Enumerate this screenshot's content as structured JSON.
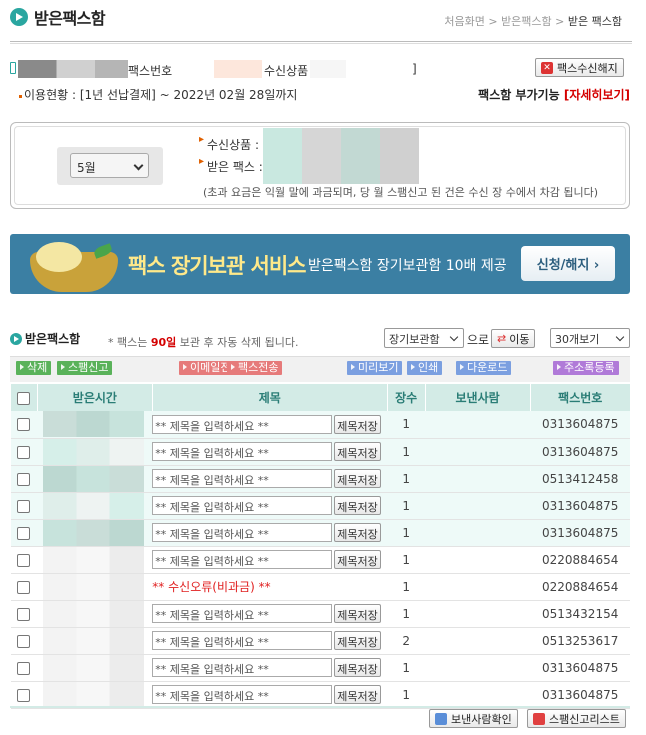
{
  "header": {
    "title": "받은팩스함",
    "breadcrumb": [
      "처음화면",
      "받은팩스함",
      "받은 팩스함"
    ]
  },
  "info": {
    "fax_number_label": "팩스번호",
    "product_label": "수신상품",
    "bracket": "]",
    "stop_button": "팩스수신해지",
    "usage": "이용현황 : [1년 선납결제] ~ 2022년 02월 28일까지",
    "extra_label": "팩스함 부가기능",
    "extra_link": "[자세히보기]"
  },
  "month_box": {
    "month_select": "5월",
    "product_label": "수신상품 :",
    "received_label": "받은 팩스 :",
    "note": "(초과 요금은 익월 말에 과금되며, 당 월 스팸신고 된 건은 수신 장 수에서 차감 됩니다)"
  },
  "banner": {
    "title": "팩스 장기보관 서비스",
    "subtitle": "받은팩스함 장기보관함 10배 제공",
    "button": "신청/해지 ›"
  },
  "list_header": {
    "title": "받은팩스함",
    "note_pre": "* 팩스는",
    "note_days": "90일",
    "note_post": "보관 후 자동 삭제 됩니다.",
    "folder_select": "장기보관함",
    "move_text": "으로",
    "move_button": "이동",
    "view_select": "30개보기"
  },
  "toolbar": {
    "delete": "삭제",
    "spam": "스팸신고",
    "email": "이메일전달",
    "fax_send": "팩스전송",
    "preview": "미리보기",
    "print": "인쇄",
    "download": "다운로드",
    "address": "주소록등록"
  },
  "table": {
    "columns": [
      "받은시간",
      "제목",
      "장수",
      "보낸사람",
      "팩스번호"
    ],
    "title_placeholder": "** 제목을 입력하세요 **",
    "save_label": "제목저장",
    "error_label": "** 수신오류(비과금) **",
    "rows": [
      {
        "pages": "1",
        "fax": "0313604875",
        "hl": true,
        "error": false
      },
      {
        "pages": "1",
        "fax": "0313604875",
        "hl": true,
        "error": false
      },
      {
        "pages": "1",
        "fax": "0513412458",
        "hl": true,
        "error": false
      },
      {
        "pages": "1",
        "fax": "0313604875",
        "hl": true,
        "error": false
      },
      {
        "pages": "1",
        "fax": "0313604875",
        "hl": true,
        "error": false
      },
      {
        "pages": "1",
        "fax": "0220884654",
        "hl": false,
        "error": false
      },
      {
        "pages": "1",
        "fax": "0220884654",
        "hl": false,
        "error": true
      },
      {
        "pages": "1",
        "fax": "0513432154",
        "hl": false,
        "error": false
      },
      {
        "pages": "2",
        "fax": "0513253617",
        "hl": false,
        "error": false
      },
      {
        "pages": "1",
        "fax": "0313604875",
        "hl": false,
        "error": false
      },
      {
        "pages": "1",
        "fax": "0313604875",
        "hl": false,
        "error": false
      }
    ]
  },
  "footer": {
    "sender_check": "보낸사람확인",
    "spam_list": "스팸신고리스트"
  }
}
